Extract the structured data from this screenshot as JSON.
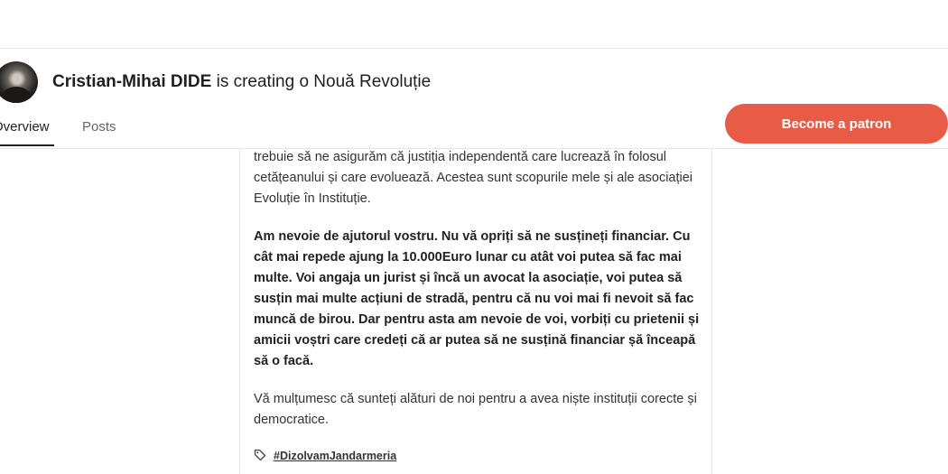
{
  "creator": {
    "name": "Cristian-Mihai DIDE",
    "tagline": " is creating o Nouă Revoluție"
  },
  "tabs": [
    {
      "label": "Overview",
      "active": true
    },
    {
      "label": "Posts",
      "active": false
    }
  ],
  "actions": {
    "become_patron_label": "Become a patron",
    "accent_color": "#e85b46"
  },
  "post": {
    "paragraphs": [
      "trebuie să ne asigurăm că justiția independentă care lucrează în folosul cetățeanului și care evoluează. Acestea sunt scopurile mele și ale asociației Evoluție în Instituție.",
      "Am nevoie de ajutorul vostru. Nu vă opriți să ne susțineți financiar. Cu cât mai repede ajung la 10.000Euro lunar cu atât voi putea să fac mai multe. Voi angaja un jurist și încă un avocat la asociație, voi putea să susțin mai multe acțiuni de stradă, pentru că nu voi mai fi nevoit să fac muncă de birou. Dar pentru asta am nevoie de voi, vorbiți cu prietenii și amicii voștri care credeți că ar putea să ne susțină financiar șă înceapă să o facă.",
      "Vă mulțumesc că sunteți alături de noi pentru a avea niște instituții corecte și democratice."
    ],
    "tag": "#DizolvamJandarmeria",
    "tag_icon": "tag-icon"
  }
}
